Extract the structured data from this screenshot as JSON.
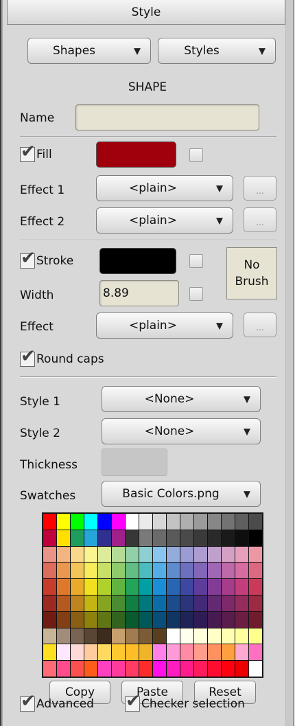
{
  "panel": {
    "title": "Style"
  },
  "top": {
    "shapes_label": "Shapes",
    "styles_label": "Styles",
    "section_label": "SHAPE"
  },
  "name": {
    "label": "Name",
    "value": ""
  },
  "fill": {
    "label": "Fill",
    "checked": true,
    "color": "#a0000c"
  },
  "effect1": {
    "label": "Effect 1",
    "value": "<plain>",
    "ellipsis": "..."
  },
  "effect2": {
    "label": "Effect 2",
    "value": "<plain>",
    "ellipsis": "..."
  },
  "stroke": {
    "label": "Stroke",
    "checked": true,
    "color": "#000000"
  },
  "width": {
    "label": "Width",
    "value": "8.89"
  },
  "brush": {
    "line1": "No",
    "line2": "Brush"
  },
  "stroke_effect": {
    "label": "Effect",
    "value": "<plain>",
    "ellipsis": "..."
  },
  "round_caps": {
    "label": "Round caps",
    "checked": true
  },
  "style1": {
    "label": "Style 1",
    "value": "<None>"
  },
  "style2": {
    "label": "Style 2",
    "value": "<None>"
  },
  "thickness": {
    "label": "Thickness"
  },
  "swatches": {
    "label": "Swatches",
    "value": "Basic Colors.png",
    "colors": [
      [
        "#ff0000",
        "#ffff00",
        "#00ff00",
        "#00ffff",
        "#0000ff",
        "#ff00ff",
        "#ffffff",
        "#ebebeb",
        "#d7d7d7",
        "#c3c3c3",
        "#afafaf",
        "#9b9b9b",
        "#878787",
        "#737373",
        "#5f5f5f",
        "#4b4b4b"
      ],
      [
        "#c0003c",
        "#ffe000",
        "#1e9e5a",
        "#26a5d8",
        "#303090",
        "#a0208a",
        "#373737",
        "#7a7a7a",
        "#6a6a6a",
        "#5a5a5a",
        "#4a4a4a",
        "#3a3a3a",
        "#2a2a2a",
        "#1a1a1a",
        "#0e0e0e",
        "#000000"
      ],
      [
        "#e89488",
        "#f2b480",
        "#f8d88a",
        "#fcf490",
        "#dcec9a",
        "#b4dc96",
        "#92d0a8",
        "#8cd0d4",
        "#8ac4f0",
        "#94acdc",
        "#9c9cd4",
        "#ac9cd0",
        "#c0a0cc",
        "#d4a0c4",
        "#e6a0bc",
        "#ec98a4"
      ],
      [
        "#dc6c5c",
        "#ea9850",
        "#f2c45a",
        "#f8ec5c",
        "#c8e068",
        "#90cc6c",
        "#62be84",
        "#4cbcc0",
        "#52aee4",
        "#5e8ccc",
        "#6c70be",
        "#8466b8",
        "#a068b4",
        "#be6aa8",
        "#d66ca0",
        "#dc6882"
      ],
      [
        "#c83c2c",
        "#e0782c",
        "#eaaa2a",
        "#f2e020",
        "#b0d02c",
        "#62b440",
        "#22a45a",
        "#02a0a4",
        "#1a8ed6",
        "#2866b4",
        "#3e48a2",
        "#5e3c9a",
        "#823c96",
        "#a63c8a",
        "#c43e7c",
        "#c83a58"
      ],
      [
        "#9c2a20",
        "#b45a20",
        "#be8420",
        "#c4b414",
        "#86a422",
        "#4a8c32",
        "#127e44",
        "#00787c",
        "#0c6ca6",
        "#1c4c8c",
        "#2c347c",
        "#442a76",
        "#622a72",
        "#7e2a6a",
        "#962c5e",
        "#9c2a42"
      ],
      [
        "#701c14",
        "#823e14",
        "#8a5e14",
        "#8e820e",
        "#607616",
        "#326420",
        "#0a5a30",
        "#005858",
        "#084e78",
        "#123664",
        "#1e2458",
        "#301c54",
        "#461c50",
        "#5a1c4c",
        "#6c1e42",
        "#701c2e"
      ],
      [
        "#c8b496",
        "#a08c78",
        "#786450",
        "#5a4632",
        "#3c2c1e",
        "#c8a06e",
        "#a07c50",
        "#7c5c36",
        "#5a3e20",
        "#ffffff",
        "#fffff0",
        "#ffffdc",
        "#ffffc8",
        "#ffffb4",
        "#ffffa0",
        "#ffff8c"
      ],
      [
        "#ffe020",
        "#ffe8ff",
        "#ffd8d8",
        "#ffcca0",
        "#ffd860",
        "#ffc830",
        "#ffbe28",
        "#f0b428",
        "#ff80e8",
        "#ff9ad8",
        "#ff8ca4",
        "#ff9c8c",
        "#ff9060",
        "#ffa040",
        "#ffa8d0",
        "#ff70c0"
      ],
      [
        "#ff6c78",
        "#ff4c8c",
        "#ff5050",
        "#ff5c1c",
        "#ff40c0",
        "#ff3c9c",
        "#ff3c64",
        "#ff2c2c",
        "#ff10e8",
        "#ff1cc0",
        "#ff1c8c",
        "#ff1c5c",
        "#ff0c30",
        "#ff0010",
        "#ee0000",
        "#ffffff"
      ]
    ]
  },
  "actions": {
    "copy": "Copy",
    "paste": "Paste",
    "reset": "Reset"
  },
  "footer": {
    "advanced_label": "Advanced",
    "advanced_checked": true,
    "checker_label": "Checker selection",
    "checker_checked": true
  }
}
